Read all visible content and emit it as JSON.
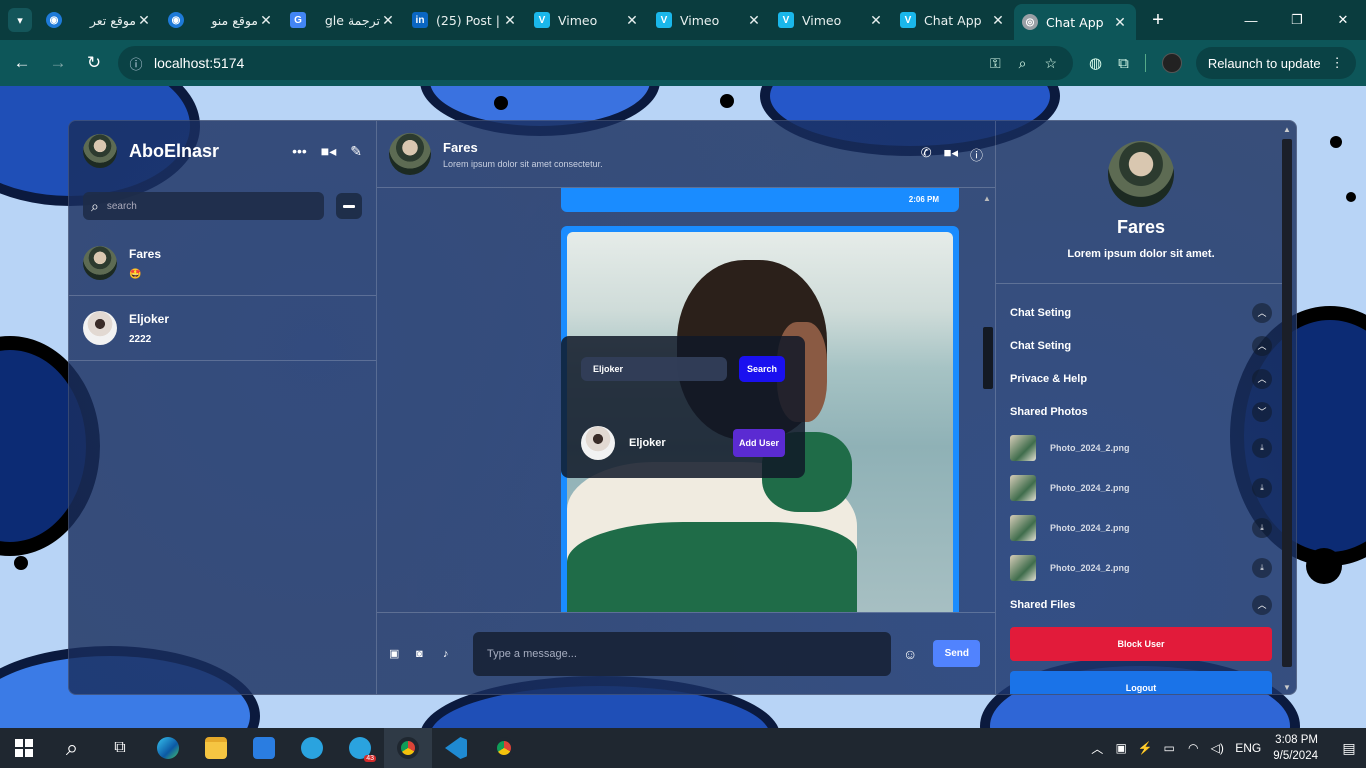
{
  "browser": {
    "tabs": [
      {
        "title": "موقع تعر",
        "favicon": "globe-blue-icon",
        "color": "#1e7ad8"
      },
      {
        "title": "موقع منو",
        "favicon": "globe-blue-icon",
        "color": "#1e7ad8"
      },
      {
        "title": "ترجمة gle",
        "favicon": "google-translate-icon",
        "color": "#4285f4"
      },
      {
        "title": "(25) Post |",
        "favicon": "linkedin-icon",
        "color": "#0a66c2"
      },
      {
        "title": "Vimeo",
        "favicon": "vimeo-icon",
        "color": "#1ab7ea"
      },
      {
        "title": "Vimeo",
        "favicon": "vimeo-icon",
        "color": "#1ab7ea"
      },
      {
        "title": "Vimeo",
        "favicon": "vimeo-icon",
        "color": "#1ab7ea"
      },
      {
        "title": "Chat App",
        "favicon": "vimeo-icon",
        "color": "#1ab7ea"
      },
      {
        "title": "Chat App",
        "favicon": "globe-icon",
        "color": "#9aa0a6",
        "active": true
      }
    ],
    "url": "localhost:5174",
    "relaunch_label": "Relaunch to update"
  },
  "app": {
    "current_user": {
      "name": "AboElnasr"
    },
    "search": {
      "placeholder": "search"
    },
    "chats": [
      {
        "name": "Fares",
        "last_message": "🤩"
      },
      {
        "name": "Eljoker",
        "last_message": "2222"
      }
    ],
    "chat_header": {
      "name": "Fares",
      "status": "Lorem ipsum dolor sit amet consectetur."
    },
    "messages": {
      "time": "2:06 PM"
    },
    "add_user": {
      "input_value": "Eljoker",
      "search_label": "Search",
      "result_name": "Eljoker",
      "add_label": "Add User"
    },
    "composer": {
      "placeholder": "Type a message...",
      "send_label": "Send"
    },
    "detail": {
      "name": "Fares",
      "bio": "Lorem ipsum dolor sit amet.",
      "options": [
        "Chat Seting",
        "Chat Seting",
        "Privace & Help",
        "Shared Photos"
      ],
      "photos": [
        "Photo_2024_2.png",
        "Photo_2024_2.png",
        "Photo_2024_2.png",
        "Photo_2024_2.png"
      ],
      "shared_files_label": "Shared Files",
      "block_label": "Block User",
      "logout_label": "Logout"
    }
  },
  "taskbar": {
    "time": "3:08 PM",
    "date": "9/5/2024",
    "language": "ENG",
    "telegram_badge": "43"
  }
}
